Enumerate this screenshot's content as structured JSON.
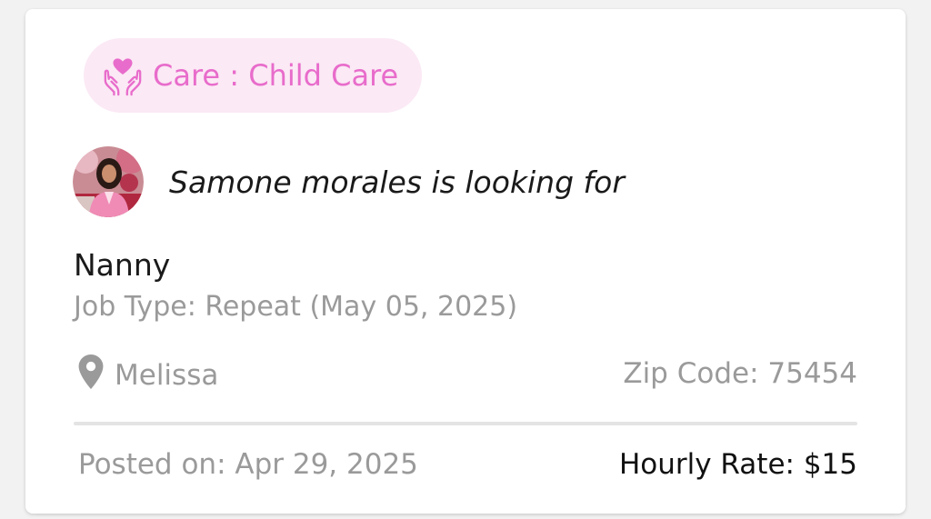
{
  "card": {
    "category": {
      "icon": "heart-in-hands-icon",
      "label": "Care :  Child Care",
      "color": "#e86ccb",
      "background": "#fbe9f5"
    },
    "poster": {
      "avatar_icon": "user-avatar",
      "text": "Samone morales is looking for"
    },
    "job": {
      "title": "Nanny",
      "type": "Job Type: Repeat (May 05, 2025)"
    },
    "location": {
      "icon": "map-pin-icon",
      "city": "Melissa",
      "zip": "Zip Code: 75454"
    },
    "footer": {
      "posted": "Posted on: Apr 29, 2025",
      "rate": "Hourly Rate: $15"
    }
  }
}
